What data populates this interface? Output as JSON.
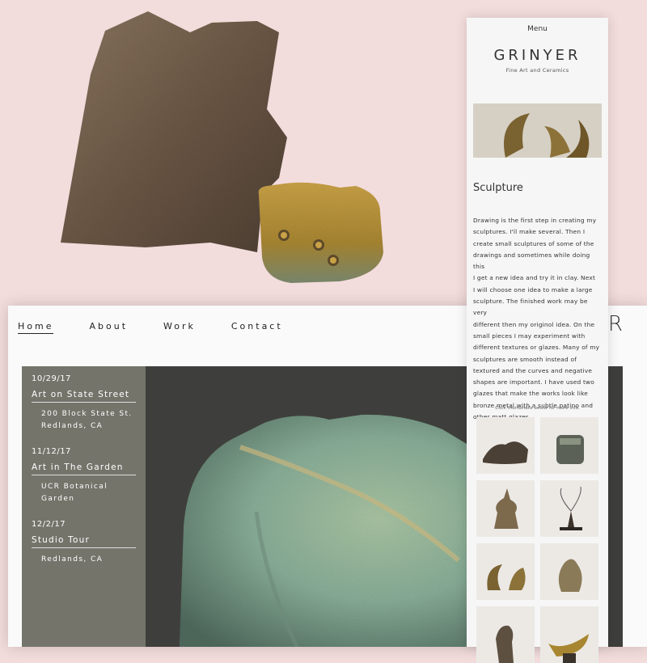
{
  "desktop": {
    "nav": [
      {
        "label": "Home"
      },
      {
        "label": "About"
      },
      {
        "label": "Work"
      },
      {
        "label": "Contact"
      }
    ],
    "logo_fragment": "R",
    "events": [
      {
        "date": "10/29/17",
        "title": "Art on State Street",
        "address": [
          "200 Block State St.",
          "Redlands, CA"
        ]
      },
      {
        "date": "11/12/17",
        "title": "Art in The Garden",
        "address": [
          "UCR Botanical",
          "Garden"
        ]
      },
      {
        "date": "12/2/17",
        "title": "Studio Tour",
        "address": [
          "Redlands, CA"
        ]
      }
    ]
  },
  "mobile": {
    "menu_label": "Menu",
    "logo": "GRINYER",
    "tagline": "Fine Art and Ceramics",
    "section_title": "Sculpture",
    "body_lines": [
      "Drawing is the first step in creating my",
      "sculptures. I'll make several. Then I",
      "create small sculptures of some of the",
      "drawings and sometimes while doing this",
      "I get a new idea and try it in clay. Next",
      "I will choose one idea to make a large",
      "sculpture. The finished work may be very",
      "different then my originol idea. On the",
      "small pieces I may experiment with",
      "different textures or glazes. Many of my",
      "sculptures are smooth instead of",
      "textured and the curves and negative",
      "shapes are important. I have used two",
      "glazes that make the works look like",
      "bronze metal with a subtle patino and",
      "other matt glazes."
    ],
    "thumb_caption": "Click thumbnails below for more info."
  },
  "colors": {
    "background": "#f3dcdc",
    "event_panel": "#787870",
    "clay_brown": "#6e5a47",
    "glaze_gold": "#b08a2e",
    "glaze_turquoise": "#8fb09a"
  }
}
